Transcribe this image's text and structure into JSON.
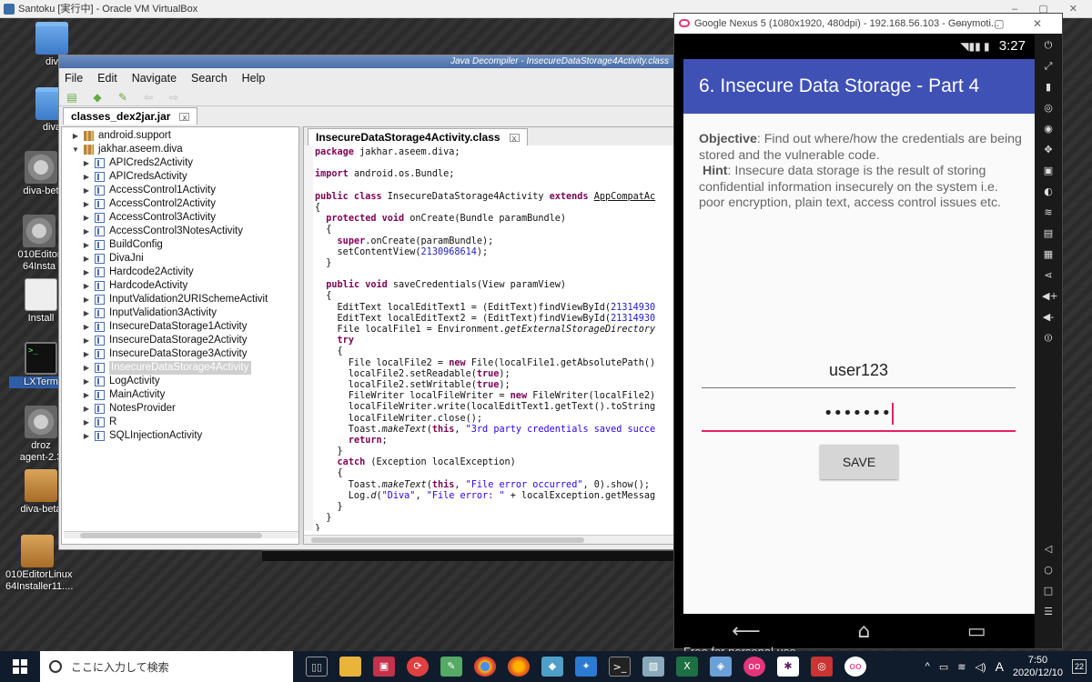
{
  "host": {
    "title": "Santoku [実行中] - Oracle VM VirtualBox"
  },
  "desktop": {
    "icons": [
      {
        "label": "div",
        "kind": "folder"
      },
      {
        "label": "diva",
        "kind": "folder"
      },
      {
        "label": "diva-bet",
        "kind": "gear"
      },
      {
        "label": "010Editor\n64Insta",
        "kind": "gear"
      },
      {
        "label": "Install",
        "kind": "doc"
      },
      {
        "label": "LXTerm",
        "kind": "term"
      },
      {
        "label": "droz\nagent-2.3",
        "kind": "gear"
      },
      {
        "label": "diva-beta",
        "kind": "pkg"
      },
      {
        "label": "010EditorLinux\n64Installer11....",
        "kind": "pkg"
      }
    ]
  },
  "jdgui": {
    "title": "Java Decompiler - InsecureDataStorage4Activity.class",
    "menu": [
      "File",
      "Edit",
      "Navigate",
      "Search",
      "Help"
    ],
    "file_tab": "classes_dex2jar.jar",
    "editor_tab": "InsecureDataStorage4Activity.class",
    "tree": [
      {
        "label": "android.support",
        "kind": "package",
        "depth": 0,
        "expanded": false
      },
      {
        "label": "jakhar.aseem.diva",
        "kind": "package",
        "depth": 0,
        "expanded": true
      },
      {
        "label": "APICreds2Activity",
        "kind": "class",
        "depth": 1
      },
      {
        "label": "APICredsActivity",
        "kind": "class",
        "depth": 1
      },
      {
        "label": "AccessControl1Activity",
        "kind": "class",
        "depth": 1
      },
      {
        "label": "AccessControl2Activity",
        "kind": "class",
        "depth": 1
      },
      {
        "label": "AccessControl3Activity",
        "kind": "class",
        "depth": 1
      },
      {
        "label": "AccessControl3NotesActivity",
        "kind": "class",
        "depth": 1
      },
      {
        "label": "BuildConfig",
        "kind": "class",
        "depth": 1
      },
      {
        "label": "DivaJni",
        "kind": "class",
        "depth": 1
      },
      {
        "label": "Hardcode2Activity",
        "kind": "class",
        "depth": 1
      },
      {
        "label": "HardcodeActivity",
        "kind": "class",
        "depth": 1
      },
      {
        "label": "InputValidation2URISchemeActivit",
        "kind": "class",
        "depth": 1
      },
      {
        "label": "InputValidation3Activity",
        "kind": "class",
        "depth": 1
      },
      {
        "label": "InsecureDataStorage1Activity",
        "kind": "class",
        "depth": 1
      },
      {
        "label": "InsecureDataStorage2Activity",
        "kind": "class",
        "depth": 1
      },
      {
        "label": "InsecureDataStorage3Activity",
        "kind": "class",
        "depth": 1
      },
      {
        "label": "InsecureDataStorage4Activity",
        "kind": "class",
        "depth": 1,
        "selected": true
      },
      {
        "label": "LogActivity",
        "kind": "class",
        "depth": 1
      },
      {
        "label": "MainActivity",
        "kind": "class",
        "depth": 1
      },
      {
        "label": "NotesProvider",
        "kind": "class",
        "depth": 1
      },
      {
        "label": "R",
        "kind": "class",
        "depth": 1
      },
      {
        "label": "SQLInjectionActivity",
        "kind": "class",
        "depth": 1
      }
    ],
    "code": [
      [
        [
          "kw",
          "package"
        ],
        [
          "t",
          " jakhar.aseem.diva;"
        ]
      ],
      [],
      [
        [
          "kw",
          "import"
        ],
        [
          "t",
          " android.os.Bundle;"
        ]
      ],
      [],
      [
        [
          "kw",
          "public class"
        ],
        [
          "t",
          " InsecureDataStorage4Activity "
        ],
        [
          "kw",
          "extends"
        ],
        [
          "t",
          " "
        ],
        [
          "ul",
          "AppCompatAc"
        ]
      ],
      [
        [
          "t",
          "{"
        ]
      ],
      [
        [
          "t",
          "  "
        ],
        [
          "kw",
          "protected void"
        ],
        [
          "t",
          " onCreate(Bundle paramBundle)"
        ]
      ],
      [
        [
          "t",
          "  {"
        ]
      ],
      [
        [
          "t",
          "    "
        ],
        [
          "kw",
          "super"
        ],
        [
          "t",
          ".onCreate(paramBundle);"
        ]
      ],
      [
        [
          "t",
          "    setContentView("
        ],
        [
          "num",
          "2130968614"
        ],
        [
          "t",
          ");"
        ]
      ],
      [
        [
          "t",
          "  }"
        ]
      ],
      [],
      [
        [
          "t",
          "  "
        ],
        [
          "kw",
          "public void"
        ],
        [
          "t",
          " saveCredentials(View paramView)"
        ]
      ],
      [
        [
          "t",
          "  {"
        ]
      ],
      [
        [
          "t",
          "    EditText localEditText1 = (EditText)findViewById("
        ],
        [
          "num",
          "21314930"
        ]
      ],
      [
        [
          "t",
          "    EditText localEditText2 = (EditText)findViewById("
        ],
        [
          "num",
          "21314930"
        ]
      ],
      [
        [
          "t",
          "    File localFile1 = Environment."
        ],
        [
          "it",
          "getExternalStorageDirectory"
        ]
      ],
      [
        [
          "t",
          "    "
        ],
        [
          "kw",
          "try"
        ]
      ],
      [
        [
          "t",
          "    {"
        ]
      ],
      [
        [
          "t",
          "      File localFile2 = "
        ],
        [
          "kw",
          "new"
        ],
        [
          "t",
          " File(localFile1.getAbsolutePath()"
        ]
      ],
      [
        [
          "t",
          "      localFile2.setReadable("
        ],
        [
          "kw",
          "true"
        ],
        [
          "t",
          ");"
        ]
      ],
      [
        [
          "t",
          "      localFile2.setWritable("
        ],
        [
          "kw",
          "true"
        ],
        [
          "t",
          ");"
        ]
      ],
      [
        [
          "t",
          "      FileWriter localFileWriter = "
        ],
        [
          "kw",
          "new"
        ],
        [
          "t",
          " FileWriter(localFile2)"
        ]
      ],
      [
        [
          "t",
          "      localFileWriter.write(localEditText1.getText().toString"
        ]
      ],
      [
        [
          "t",
          "      localFileWriter.close();"
        ]
      ],
      [
        [
          "t",
          "      Toast."
        ],
        [
          "it",
          "makeText"
        ],
        [
          "t",
          "("
        ],
        [
          "kw",
          "this"
        ],
        [
          "t",
          ", "
        ],
        [
          "str",
          "\"3rd party credentials saved succe"
        ]
      ],
      [
        [
          "t",
          "      "
        ],
        [
          "kw",
          "return"
        ],
        [
          "t",
          ";"
        ]
      ],
      [
        [
          "t",
          "    }"
        ]
      ],
      [
        [
          "t",
          "    "
        ],
        [
          "kw",
          "catch"
        ],
        [
          "t",
          " (Exception localException)"
        ]
      ],
      [
        [
          "t",
          "    {"
        ]
      ],
      [
        [
          "t",
          "      Toast."
        ],
        [
          "it",
          "makeText"
        ],
        [
          "t",
          "("
        ],
        [
          "kw",
          "this"
        ],
        [
          "t",
          ", "
        ],
        [
          "str",
          "\"File error occurred\""
        ],
        [
          "t",
          ", 0).show();"
        ]
      ],
      [
        [
          "t",
          "      Log."
        ],
        [
          "it",
          "d"
        ],
        [
          "t",
          "("
        ],
        [
          "str",
          "\"Diva\""
        ],
        [
          "t",
          ", "
        ],
        [
          "str",
          "\"File error: \""
        ],
        [
          "t",
          " + localException.getMessag"
        ]
      ],
      [
        [
          "t",
          "    }"
        ]
      ],
      [
        [
          "t",
          "  }"
        ]
      ],
      [
        [
          "t",
          "}"
        ]
      ]
    ]
  },
  "genymotion": {
    "title": "Google Nexus 5 (1080x1920, 480dpi) - 192.168.56.103 - Genymoti...",
    "time": "3:27",
    "app_title": "6. Insecure Data Storage - Part 4",
    "objective_label": "Objective",
    "objective_text": ": Find out where/how the credentials are being stored and the vulnerable code.",
    "hint_label": "Hint",
    "hint_text": ": Insecure data storage is the result of storing confidential information insecurely on the system i.e. poor encryption, plain text, access control issues etc.",
    "username_value": "user123",
    "password_value": "•••••••",
    "save_label": "SAVE",
    "free_text": "Free for personal use"
  },
  "taskbar": {
    "search_placeholder": "ここに入力して検索",
    "clock_time": "7:50",
    "clock_date": "2020/12/10",
    "ime": "A",
    "notifications": "22"
  }
}
